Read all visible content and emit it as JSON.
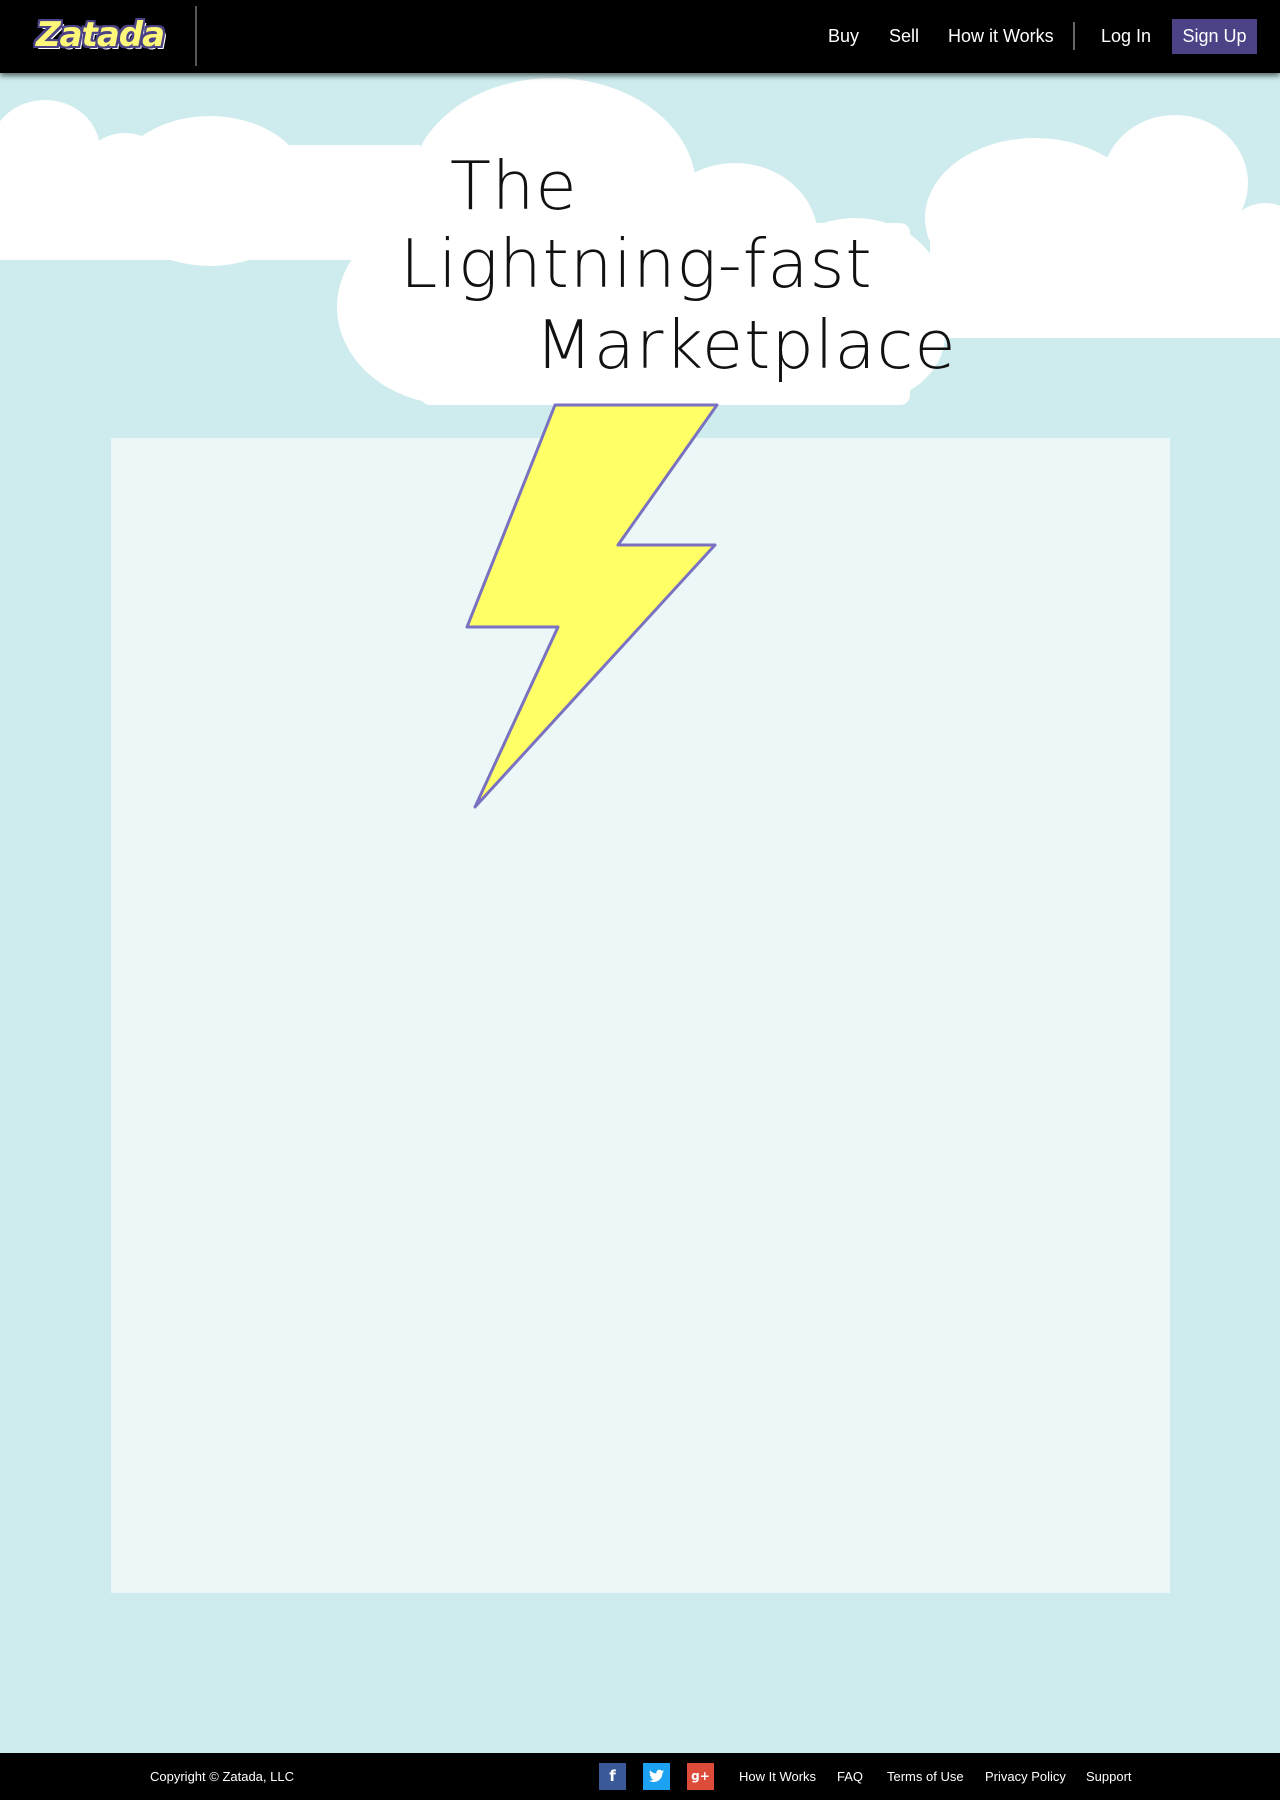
{
  "header": {
    "logo_text": "Zatada",
    "nav": {
      "buy": "Buy",
      "sell": "Sell",
      "how_it_works": "How it Works",
      "log_in": "Log In",
      "sign_up": "Sign Up"
    }
  },
  "hero": {
    "line1": "The",
    "line2": "Lightning-fast",
    "line3": "Marketplace"
  },
  "footer": {
    "copyright": "Copyright © Zatada, LLC",
    "social": {
      "facebook": "f",
      "google_plus": "g+"
    },
    "links": {
      "how_it_works": "How It Works",
      "faq": "FAQ",
      "terms": "Terms of Use",
      "privacy": "Privacy Policy",
      "support": "Support"
    }
  },
  "colors": {
    "sky": "#ceeced",
    "header_bg": "#000000",
    "signup_bg": "#4b4386",
    "bolt_yellow": "#ffff66",
    "facebook": "#3b5998",
    "twitter": "#1da1f2",
    "google_plus": "#dd4b39"
  },
  "icons": [
    "facebook-icon",
    "twitter-icon",
    "google-plus-icon",
    "lightning-bolt-icon"
  ]
}
